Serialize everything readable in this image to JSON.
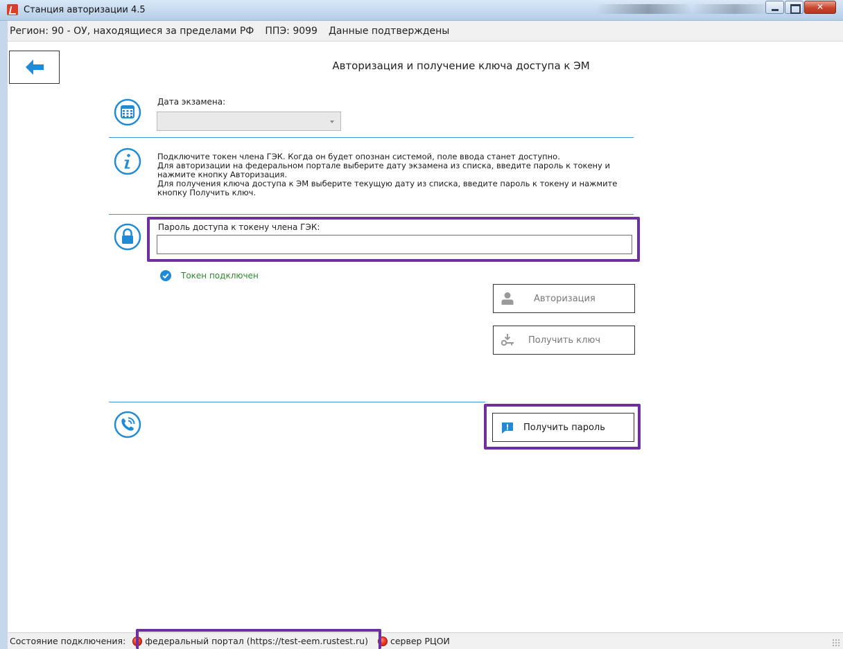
{
  "window": {
    "title": "Станция авторизации 4.5"
  },
  "infobar": {
    "region": "Регион: 90 - ОУ, находящиеся за пределами РФ",
    "ppe": "ППЭ: 9099",
    "status": "Данные подтверждены"
  },
  "page": {
    "title": "Авторизация и получение ключа доступа к ЭМ"
  },
  "exam_date": {
    "label": "Дата экзамена:",
    "selected": ""
  },
  "info": {
    "lines": [
      "Подключите токен члена ГЭК. Когда он будет опознан системой, поле ввода станет доступно.",
      "Для авторизации на федеральном портале выберите дату экзамена из списка, введите пароль к токену и",
      "нажмите кнопку Авторизация.",
      "Для получения ключа доступа к ЭМ выберите текущую дату из списка, введите пароль к токену и нажмите",
      "кнопку Получить ключ."
    ]
  },
  "password": {
    "label": "Пароль доступа к токену члена ГЭК:",
    "value": ""
  },
  "token": {
    "status": "Токен подключен"
  },
  "buttons": {
    "authorize": "Авторизация",
    "get_key": "Получить ключ",
    "get_password": "Получить пароль"
  },
  "statusbar": {
    "label": "Состояние подключения:",
    "federal_portal": "федеральный портал (https://test-eem.rustest.ru)",
    "rcoi_server": "сервер РЦОИ"
  },
  "colors": {
    "accent_blue": "#1f8ad6",
    "highlight_purple": "#6f2f9f",
    "success_green": "#2c8a2c",
    "error_red": "#ee3a25"
  }
}
